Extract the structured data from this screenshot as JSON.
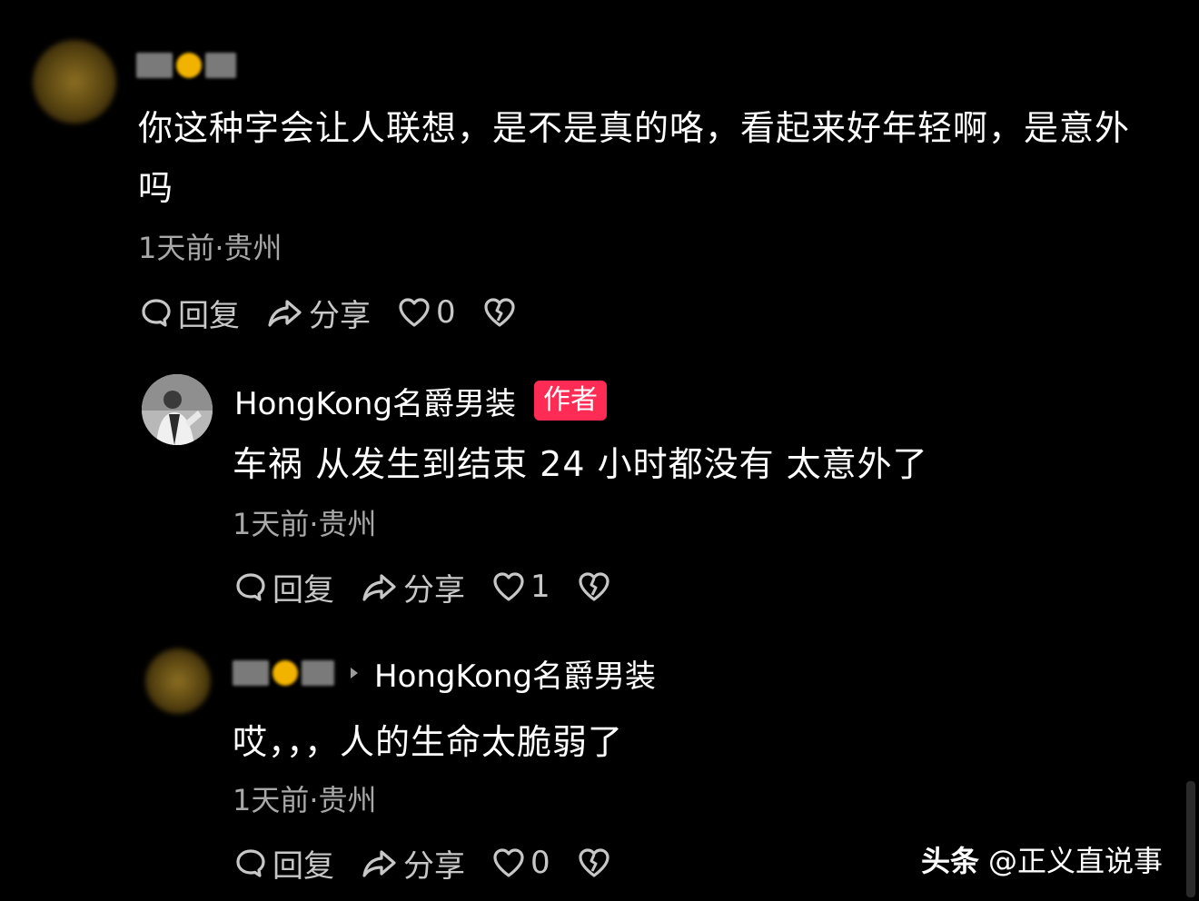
{
  "comments": [
    {
      "username": "",
      "text": "你这种字会让人联想，是不是真的咯，看起来好年轻啊，是意外吗",
      "meta": "1天前·贵州",
      "actions": {
        "reply": "回复",
        "share": "分享",
        "likes": "0"
      }
    },
    {
      "username": "HongKong名爵男装",
      "badge": "作者",
      "text": "车祸 从发生到结束 24 小时都没有 太意外了",
      "meta": "1天前·贵州",
      "actions": {
        "reply": "回复",
        "share": "分享",
        "likes": "1"
      }
    },
    {
      "username": "",
      "reply_to": "HongKong名爵男装",
      "text": "哎，，，人的生命太脆弱了",
      "meta": "1天前·贵州",
      "actions": {
        "reply": "回复",
        "share": "分享",
        "likes": "0"
      }
    }
  ],
  "watermark": {
    "brand": "头条",
    "handle": "@正义直说事"
  },
  "colors": {
    "background": "#000000",
    "badge": "#fe2c55",
    "meta": "#a8a8a8",
    "action": "#c7c7c7"
  },
  "icons": [
    "comment-icon",
    "share-icon",
    "heart-icon",
    "broken-heart-icon",
    "reply-to-arrow-icon"
  ]
}
